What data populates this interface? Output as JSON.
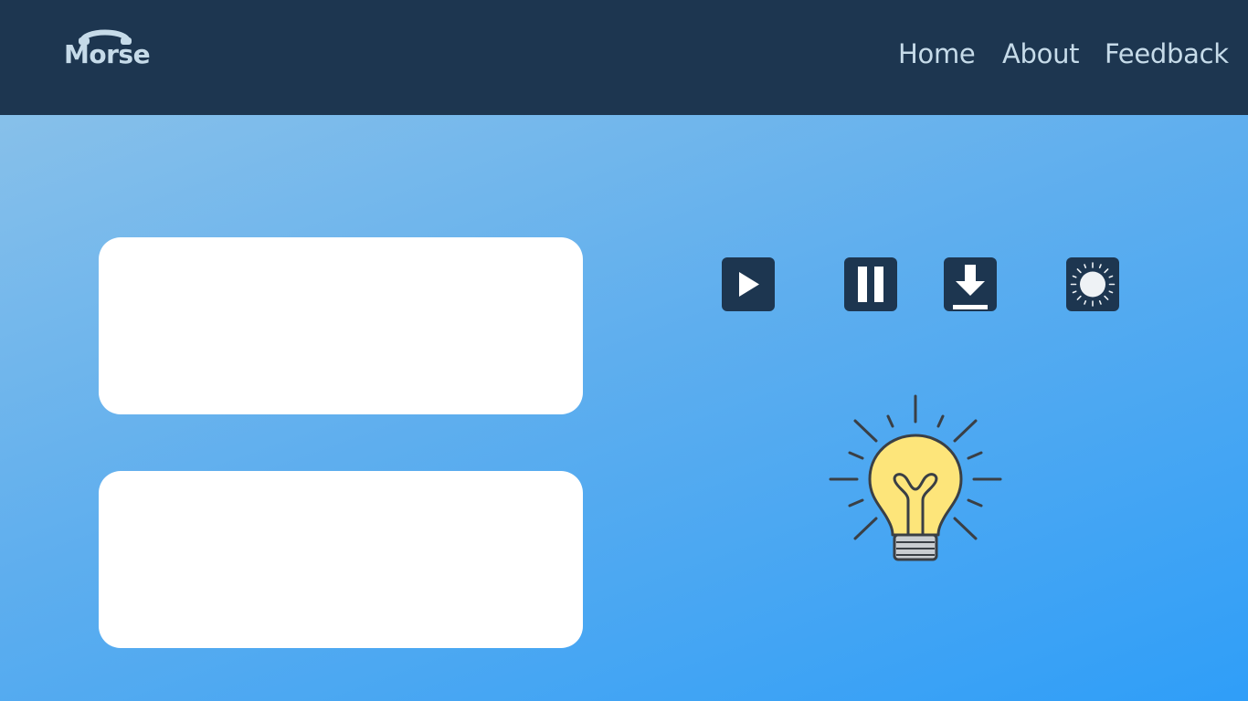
{
  "app": {
    "logo_text": "Morse"
  },
  "nav": {
    "links": [
      "Home",
      "About",
      "Feedback"
    ]
  },
  "inputs": {
    "input_text_value": "",
    "output_text_value": ""
  },
  "controls": {
    "icons": [
      "play-icon",
      "pause-icon",
      "download-icon",
      "brightness-icon"
    ]
  },
  "indicator": {
    "icon": "lightbulb-icon",
    "state": "on"
  },
  "colors": {
    "navbar": "#1d3650",
    "nav_text": "#c6dbe9",
    "button_bg": "#1d3650",
    "bulb_glass": "#fde57a",
    "background_light": "#87c0ea",
    "background_dark": "#2f9ef8"
  }
}
